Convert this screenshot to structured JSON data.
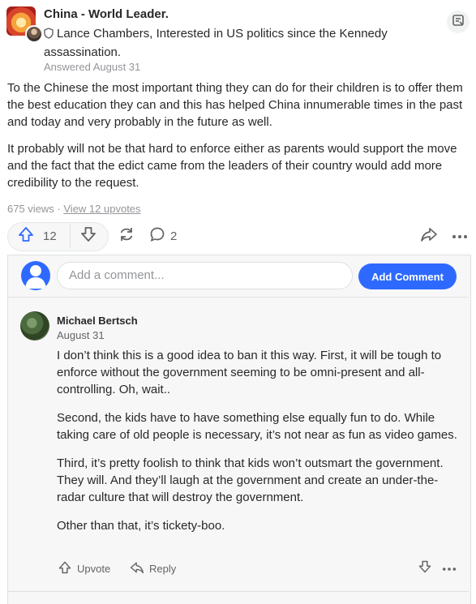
{
  "header": {
    "space_name": "China - World Leader.",
    "credential": "Lance Chambers, Interested in US politics since the Kennedy assassination.",
    "answered": "Answered August 31"
  },
  "answer": {
    "paragraphs": [
      "To the Chinese the most important thing they can do for their children is to offer them the best education they can and this has helped China innumerable times in the past and today and very probably in the future as well.",
      "It probably will not be that hard to enforce either as parents would support the move and the fact that the edict came from the leaders of their country would add more credibility to the request."
    ],
    "views": "675 views",
    "separator": " · ",
    "upvotes_link": "View 12 upvotes"
  },
  "actions": {
    "upvote_count": "12",
    "comment_count": "2"
  },
  "comments": {
    "input_placeholder": "Add a comment...",
    "add_button": "Add Comment",
    "items": [
      {
        "author": "Michael Bertsch",
        "date": "August 31",
        "paragraphs": [
          "I don’t think this is a good idea to ban it this way. First, it will be tough to enforce without the government seeming to be omni-present and all-controlling. Oh, wait..",
          "Second, the kids have to have something else equally fun to do. While taking care of old people is necessary, it’s not near as fun as video games.",
          "Third, it’s pretty foolish to think that kids won’t outsmart the government. They will. And they’ll laugh at the government and create an under-the-radar culture that will destroy the government.",
          "Other than that, it’s tickety-boo."
        ],
        "upvote_label": "Upvote",
        "reply_label": "Reply"
      }
    ]
  },
  "colors": {
    "accent": "#2e69ff",
    "text": "#282829",
    "muted": "#939598",
    "panel_bg": "#f7f7f8"
  }
}
